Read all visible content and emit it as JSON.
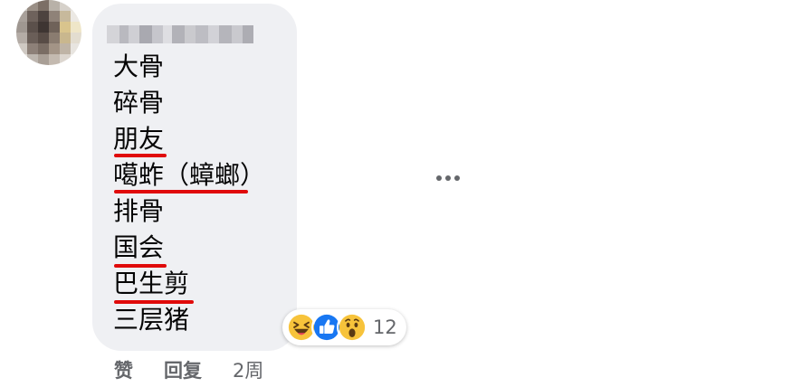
{
  "comment": {
    "author_name_censored": true,
    "lines": [
      "大骨",
      "碎骨",
      "朋友",
      "噶蚱（蟑螂）",
      "排骨",
      "国会",
      "巴生剪",
      "三层猪"
    ],
    "underlined_lines": [
      2,
      3,
      5,
      6
    ],
    "reactions": {
      "icons": [
        "laughing-emoji-icon",
        "like-thumb-icon",
        "wow-emoji-icon"
      ],
      "count": "12"
    },
    "actions": {
      "like_label": "赞",
      "reply_label": "回复",
      "time": "2周"
    }
  },
  "colors": {
    "bubble": "#eff0f3",
    "underline": "#e00a0a",
    "meta_text": "#65676b",
    "like_blue": "#1877f2"
  }
}
